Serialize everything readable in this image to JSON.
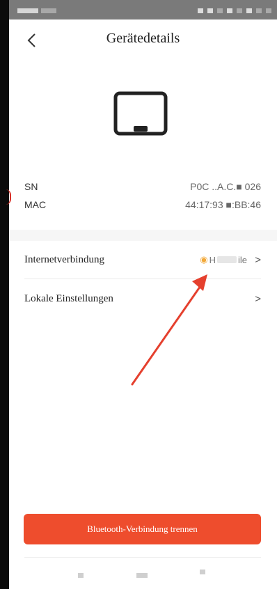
{
  "header": {
    "title": "Gerätedetails"
  },
  "device_info": [
    {
      "label": "SN",
      "value": "P0C  ..A.C.■    026"
    },
    {
      "label": "MAC",
      "value": "44:17:93 ■:BB:46"
    }
  ],
  "menu": {
    "internet_label": "Internetverbindung",
    "internet_value_prefix": "H",
    "internet_value_suffix": "ile",
    "local_label": "Lokale Einstellungen",
    "chevron": ">"
  },
  "bluetooth_button": "Bluetooth-Verbindung trennen",
  "colors": {
    "accent": "#ee4d2d",
    "arrow": "#e5402e",
    "wifi": "#f2a93b"
  },
  "icons": [
    "back-arrow-icon",
    "tablet-device-icon",
    "wifi-icon",
    "chevron-right-icon"
  ]
}
